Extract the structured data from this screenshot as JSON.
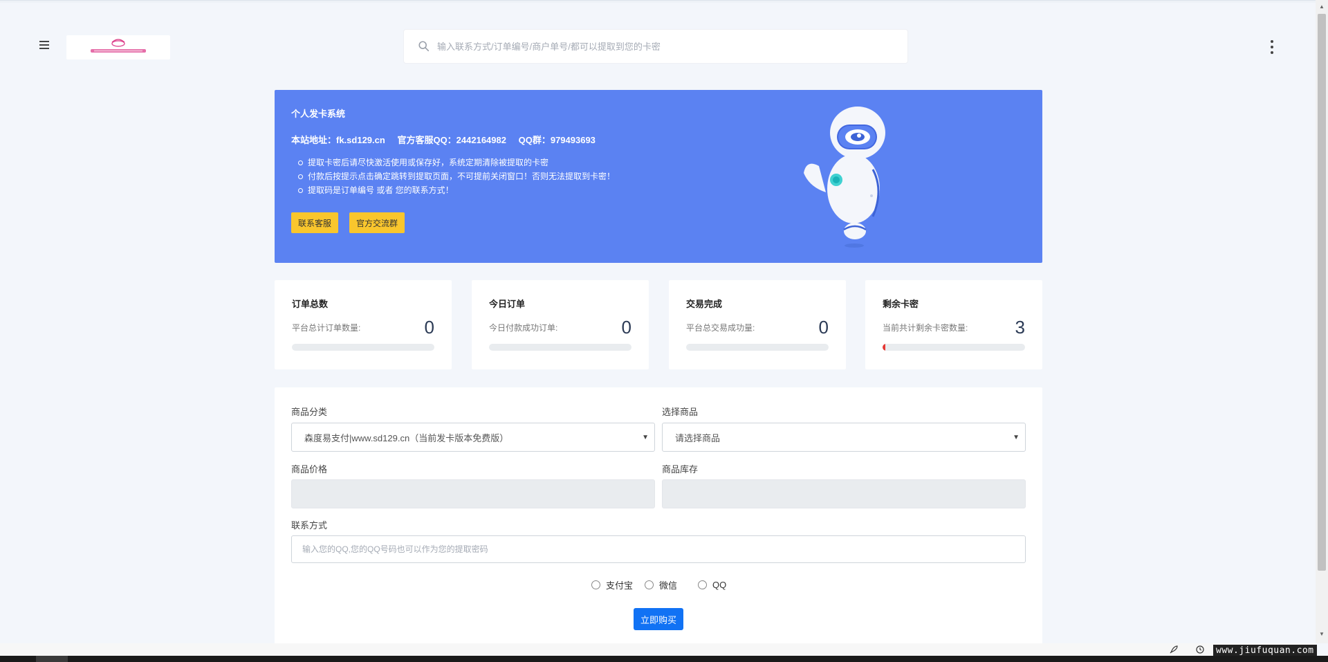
{
  "header": {
    "logo_alt": "森度易支付",
    "search_placeholder": "输入联系方式/订单编号/商户单号/都可以提取到您的卡密"
  },
  "banner": {
    "title": "个人发卡系统",
    "site_address": "本站地址：fk.sd129.cn",
    "service_qq": "官方客服QQ：2442164982",
    "qq_group": "QQ群：979493693",
    "notes": [
      "提取卡密后请尽快激活使用或保存好，系统定期清除被提取的卡密",
      "付款后按提示点击确定跳转到提取页面，不可提前关闭窗口！否则无法提取到卡密！",
      "提取码是订单编号 或者 您的联系方式！"
    ],
    "btn_contact": "联系客服",
    "btn_group": "官方交流群"
  },
  "stats": [
    {
      "title": "订单总数",
      "subtitle": "平台总计订单数量:",
      "value": "0",
      "progress": 0
    },
    {
      "title": "今日订单",
      "subtitle": "今日付款成功订单:",
      "value": "0",
      "progress": 0
    },
    {
      "title": "交易完成",
      "subtitle": "平台总交易成功量:",
      "value": "0",
      "progress": 0
    },
    {
      "title": "剩余卡密",
      "subtitle": "当前共计剩余卡密数量:",
      "value": "3",
      "progress": 0.02
    }
  ],
  "form": {
    "category_label": "商品分类",
    "category_value": "森度易支付|www.sd129.cn（当前发卡版本免费版）",
    "product_label": "选择商品",
    "product_value": "请选择商品",
    "price_label": "商品价格",
    "stock_label": "商品库存",
    "contact_label": "联系方式",
    "contact_placeholder": "输入您的QQ,您的QQ号码也可以作为您的提取密码",
    "payments": [
      "支付宝",
      "微信",
      "QQ"
    ],
    "buy_label": "立即购买"
  },
  "watermark": "www.jiufuquan.com",
  "colors": {
    "banner": "#5b82f2",
    "button_yellow": "#f9c62d",
    "buy_button": "#1172f4",
    "progress_red": "#e53935"
  }
}
